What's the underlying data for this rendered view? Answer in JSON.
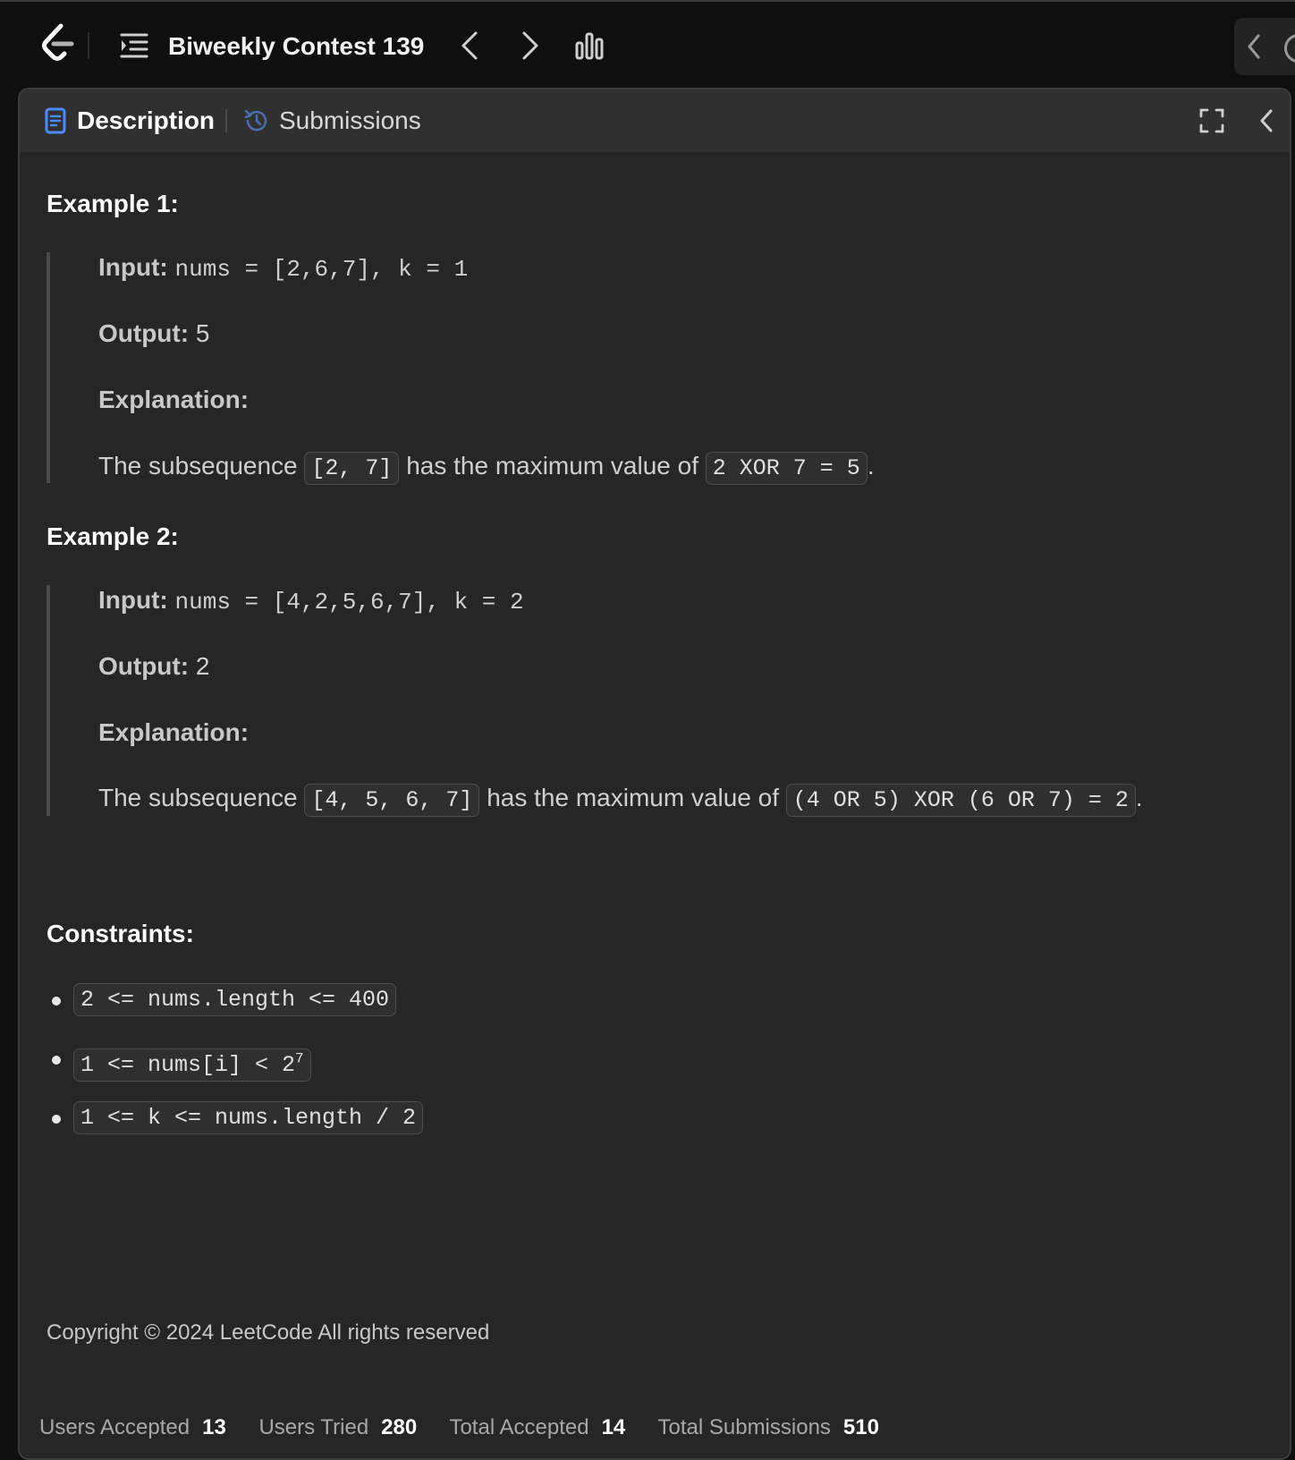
{
  "topbar": {
    "contest_title": "Biweekly Contest 139",
    "icons": [
      "leetcode-logo",
      "problem-list-icon",
      "chevron-left-icon",
      "chevron-right-icon",
      "bar-chart-icon",
      "timer-icon"
    ]
  },
  "tabs": {
    "description": "Description",
    "submissions": "Submissions"
  },
  "examples": [
    {
      "heading": "Example 1:",
      "input_label": "Input:",
      "input_value": "nums = [2,6,7], k = 1",
      "output_label": "Output:",
      "output_value": "5",
      "explanation_label": "Explanation:",
      "explanation_prefix": "The subsequence",
      "explanation_code1": "[2, 7]",
      "explanation_middle": "has the maximum value of",
      "explanation_code2": "2 XOR 7 = 5",
      "explanation_suffix": "."
    },
    {
      "heading": "Example 2:",
      "input_label": "Input:",
      "input_value": "nums = [4,2,5,6,7], k = 2",
      "output_label": "Output:",
      "output_value": "2",
      "explanation_label": "Explanation:",
      "explanation_prefix": "The subsequence",
      "explanation_code1": "[4, 5, 6, 7]",
      "explanation_middle": "has the maximum value of",
      "explanation_code2": "(4 OR 5) XOR (6 OR 7) = 2",
      "explanation_suffix": "."
    }
  ],
  "constraints": {
    "heading": "Constraints:",
    "items": [
      "2 <= nums.length <= 400",
      "1 <= nums[i] < 2",
      "1 <= k <= nums.length / 2"
    ],
    "item2_superscript": "7"
  },
  "copyright": "Copyright © 2024 LeetCode All rights reserved",
  "stats": {
    "users_accepted_label": "Users Accepted",
    "users_accepted": "13",
    "users_tried_label": "Users Tried",
    "users_tried": "280",
    "total_accepted_label": "Total Accepted",
    "total_accepted": "14",
    "total_submissions_label": "Total Submissions",
    "total_submissions": "510"
  },
  "colors": {
    "background": "#0f0f0f",
    "panel": "#262626",
    "tab_bar": "#303030",
    "accent_blue": "#4a8cff"
  }
}
